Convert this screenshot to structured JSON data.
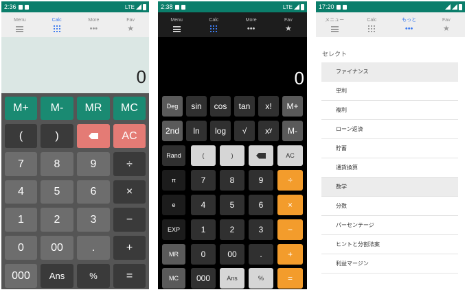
{
  "colors": {
    "accent": "#3d7cf0",
    "status_bar": "#0b7e6b",
    "green_key": "#1a8a72",
    "orange_key": "#f39c2c",
    "red_key": "#e47b75"
  },
  "phone1": {
    "status": {
      "time": "2:36",
      "network": "LTE"
    },
    "nav": [
      {
        "label": "Menu",
        "icon": "menu-icon"
      },
      {
        "label": "Calc",
        "icon": "grid-icon"
      },
      {
        "label": "More",
        "icon": "dots-icon"
      },
      {
        "label": "Fav",
        "icon": "star-icon"
      }
    ],
    "display": "0",
    "keys": {
      "mplus": "M+",
      "mminus": "M-",
      "mr": "MR",
      "mc": "MC",
      "lparen": "(",
      "rparen": ")",
      "ac": "AC",
      "n7": "7",
      "n8": "8",
      "n9": "9",
      "div": "÷",
      "n4": "4",
      "n5": "5",
      "n6": "6",
      "mul": "×",
      "n1": "1",
      "n2": "2",
      "n3": "3",
      "minus": "−",
      "n0": "0",
      "n00": "00",
      "dot": ".",
      "plus": "+",
      "n000": "000",
      "ans": "Ans",
      "pct": "%",
      "eq": "="
    }
  },
  "phone2": {
    "status": {
      "time": "2:38",
      "network": "LTE"
    },
    "nav": [
      {
        "label": "Menu",
        "icon": "menu-icon"
      },
      {
        "label": "Calc",
        "icon": "grid-icon"
      },
      {
        "label": "More",
        "icon": "dots-icon"
      },
      {
        "label": "Fav",
        "icon": "star-icon"
      }
    ],
    "display": "0",
    "keys": {
      "deg": "Deg",
      "sin": "sin",
      "cos": "cos",
      "tan": "tan",
      "xfact": "x!",
      "mplus": "M+",
      "second": "2nd",
      "ln": "ln",
      "log": "log",
      "sqrt": "√",
      "xy": "xʸ",
      "mminus": "M-",
      "rand": "Rand",
      "lparen": "(",
      "rparen": ")",
      "ac": "AC",
      "pi": "π",
      "n7": "7",
      "n8": "8",
      "n9": "9",
      "div": "÷",
      "e": "e",
      "n4": "4",
      "n5": "5",
      "n6": "6",
      "mul": "×",
      "exp": "EXP",
      "n1": "1",
      "n2": "2",
      "n3": "3",
      "minus": "−",
      "mr": "MR",
      "n0": "0",
      "n00": "00",
      "dot": ".",
      "plus": "+",
      "mc": "MC",
      "n000": "000",
      "ans": "Ans",
      "pct": "%",
      "eq": "="
    }
  },
  "phone3": {
    "status": {
      "time": "17:20"
    },
    "nav": [
      {
        "label": "メニュー",
        "icon": "menu-icon"
      },
      {
        "label": "Calc",
        "icon": "grid-icon"
      },
      {
        "label": "もっと",
        "icon": "dots-icon"
      },
      {
        "label": "Fav",
        "icon": "star-icon"
      }
    ],
    "title": "セレクト",
    "items": [
      "ファイナンス",
      "単利",
      "複利",
      "ローン返済",
      "貯蓄",
      "通貨換算",
      "数学",
      "分数",
      "パーセンテージ",
      "ヒントと分割法案",
      "利益マージン"
    ]
  }
}
